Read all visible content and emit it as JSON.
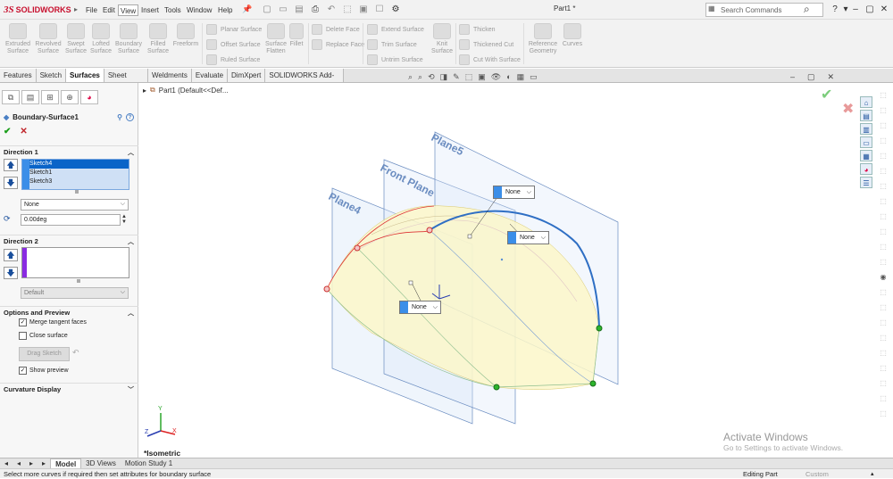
{
  "app": {
    "brand_ds": "3S",
    "brand_name": "SOLIDWORKS",
    "doc_title": "Part1 *"
  },
  "menu": [
    "File",
    "Edit",
    "View",
    "Insert",
    "Tools",
    "Window",
    "Help"
  ],
  "search": {
    "placeholder": "Search Commands"
  },
  "ribbon": {
    "big": [
      {
        "l1": "Extruded",
        "l2": "Surface"
      },
      {
        "l1": "Revolved",
        "l2": "Surface"
      },
      {
        "l1": "Swept",
        "l2": "Surface"
      },
      {
        "l1": "Lofted",
        "l2": "Surface"
      },
      {
        "l1": "Boundary",
        "l2": "Surface"
      },
      {
        "l1": "Filled",
        "l2": "Surface"
      },
      {
        "l1": "Freeform",
        "l2": ""
      }
    ],
    "group1": [
      "Planar Surface",
      "Offset Surface",
      "Ruled Surface"
    ],
    "surface_flatten": {
      "l1": "Surface",
      "l2": "Flatten"
    },
    "fillet": "Fillet",
    "group2": [
      "Delete Face",
      "Replace Face"
    ],
    "group3": [
      "Extend Surface",
      "Trim Surface",
      "Untrim Surface"
    ],
    "knit": {
      "l1": "Knit",
      "l2": "Surface"
    },
    "group4": [
      "Thicken",
      "Thickened Cut",
      "Cut With Surface"
    ],
    "refgeo": {
      "l1": "Reference",
      "l2": "Geometry"
    },
    "curves": "Curves"
  },
  "tabs": [
    "Features",
    "Sketch",
    "Surfaces",
    "Sheet Metal",
    "Weldments",
    "Evaluate",
    "DimXpert",
    "SOLIDWORKS Add-Ins"
  ],
  "panel": {
    "feature_name": "Boundary-Surface1",
    "direction1": {
      "title": "Direction 1",
      "items": [
        "Sketch4",
        "Sketch1",
        "Sketch3"
      ],
      "tangency": "None",
      "angle": "0.00deg"
    },
    "direction2": {
      "title": "Direction 2",
      "tangency": "Default"
    },
    "options": {
      "title": "Options and Preview",
      "merge": "Merge tangent faces",
      "close": "Close surface",
      "drag": "Drag Sketch",
      "preview": "Show preview"
    },
    "curvature": "Curvature Display"
  },
  "viewport": {
    "tree_label": "Part1  (Default<<Def...",
    "planes": [
      "Plane5",
      "Front Plane",
      "Plane4"
    ],
    "callouts": [
      "None",
      "None",
      "None"
    ],
    "orientation": "*Isometric",
    "axes": {
      "x": "X",
      "y": "Y",
      "z": "Z"
    }
  },
  "watermark": {
    "line1": "Activate Windows",
    "line2": "Go to Settings to activate Windows."
  },
  "bottom_tabs": [
    "Model",
    "3D Views",
    "Motion Study 1"
  ],
  "status": {
    "message": "Select more curves if required then set attributes for boundary surface",
    "mode": "Editing Part",
    "units": "Custom"
  }
}
